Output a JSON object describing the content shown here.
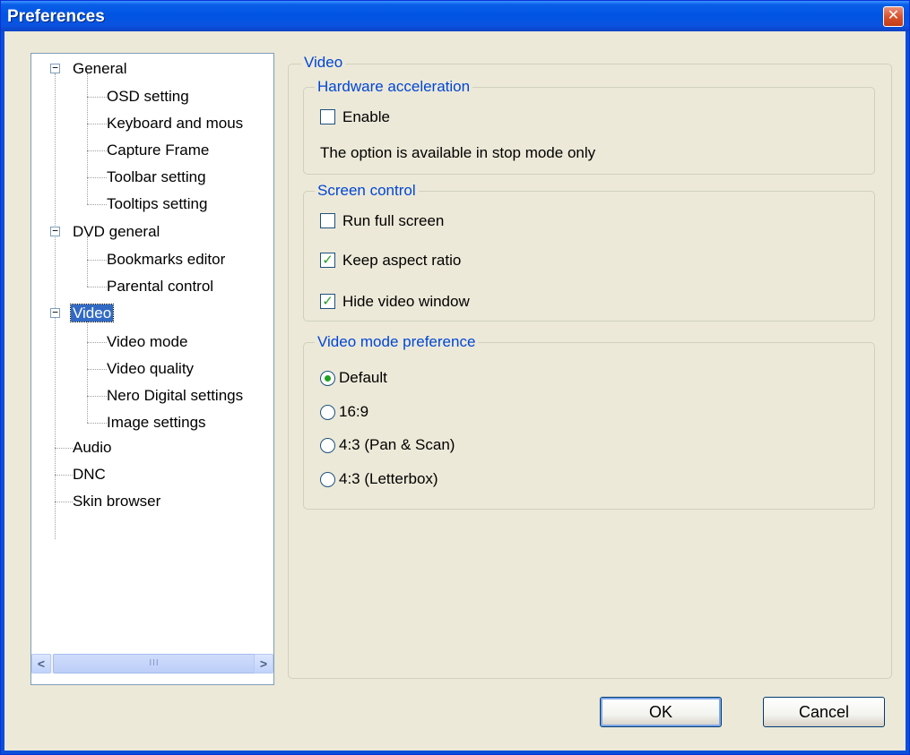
{
  "window": {
    "title": "Preferences"
  },
  "tree": {
    "items": [
      {
        "label": "General"
      },
      {
        "label": "OSD setting"
      },
      {
        "label": "Keyboard and mous"
      },
      {
        "label": "Capture Frame"
      },
      {
        "label": "Toolbar setting"
      },
      {
        "label": "Tooltips setting"
      },
      {
        "label": "DVD general"
      },
      {
        "label": "Bookmarks editor"
      },
      {
        "label": "Parental control"
      },
      {
        "label": "Video"
      },
      {
        "label": "Video mode"
      },
      {
        "label": "Video quality"
      },
      {
        "label": "Nero Digital settings"
      },
      {
        "label": "Image settings"
      },
      {
        "label": "Audio"
      },
      {
        "label": "DNC"
      },
      {
        "label": "Skin browser"
      }
    ],
    "expanded_symbol": "−",
    "scroll_left": "<",
    "scroll_right": ">",
    "scroll_grip": "III"
  },
  "panel": {
    "title": "Video",
    "hardware": {
      "title": "Hardware acceleration",
      "enable_label": "Enable",
      "enable_checked": false,
      "note": "The option is available in stop mode only"
    },
    "screen": {
      "title": "Screen control",
      "full_screen_label": "Run full screen",
      "keep_aspect_label": "Keep aspect ratio",
      "hide_window_label": "Hide video window",
      "check_mark": "✓"
    },
    "mode": {
      "title": "Video mode preference",
      "options": [
        "Default",
        "16:9",
        "4:3 (Pan & Scan)",
        "4:3 (Letterbox)"
      ],
      "selected": "Default"
    }
  },
  "buttons": {
    "ok": "OK",
    "cancel": "Cancel"
  },
  "colors": {
    "accent": "#0046d5",
    "selection": "#316ac5",
    "check": "#21a121"
  }
}
